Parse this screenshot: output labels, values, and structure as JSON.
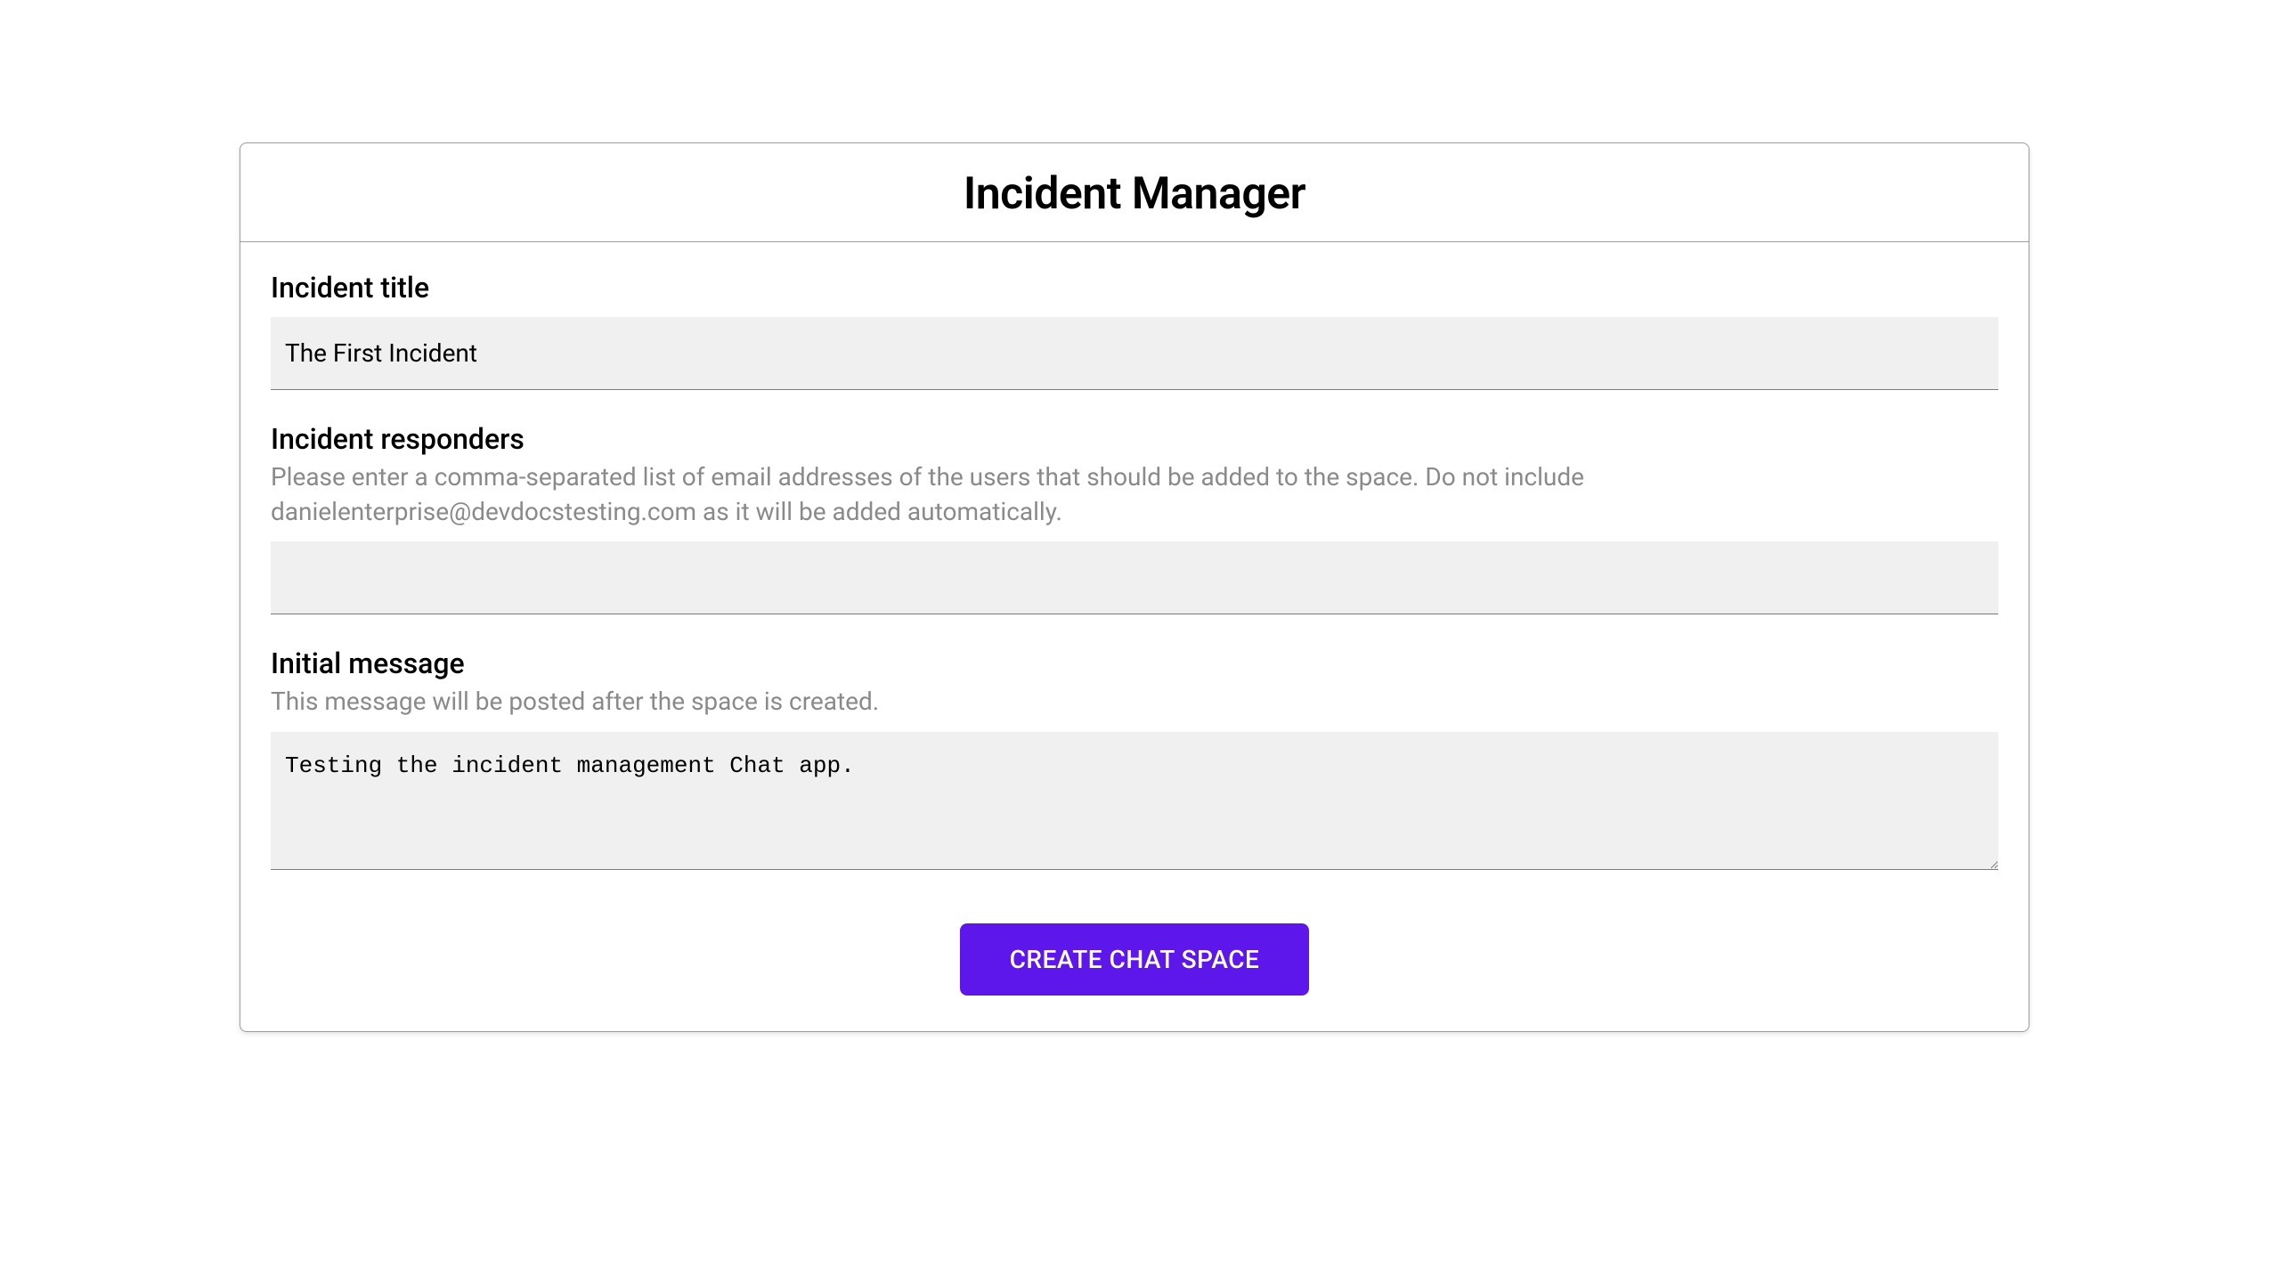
{
  "header": {
    "title": "Incident Manager"
  },
  "fields": {
    "incident_title": {
      "label": "Incident title",
      "value": "The First Incident"
    },
    "incident_responders": {
      "label": "Incident responders",
      "helper": "Please enter a comma-separated list of email addresses of the users that should be added to the space. Do not include danielenterprise@devdocstesting.com as it will be added automatically.",
      "value": ""
    },
    "initial_message": {
      "label": "Initial message",
      "helper": "This message will be posted after the space is created.",
      "value": "Testing the incident management Chat app."
    }
  },
  "actions": {
    "create_label": "CREATE CHAT SPACE"
  }
}
